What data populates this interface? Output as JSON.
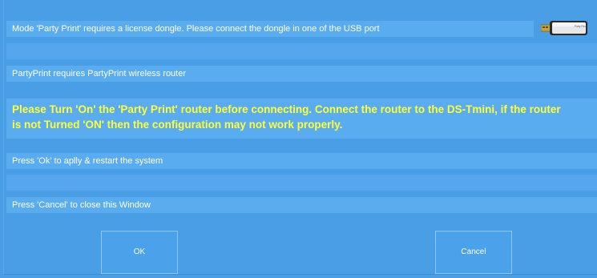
{
  "messages": {
    "dongle_notice": "Mode 'Party Print' requires a license dongle. Please connect the dongle in one of the USB port",
    "router_notice": "PartyPrint requires PartyPrint wireless router",
    "warning_line1": "Please Turn 'On' the 'Party Print' router before connecting. Connect the router to the DS-Tmini, if the router",
    "warning_line2": "is not Turned 'ON' then the configuration may not work properly.",
    "ok_hint": "Press 'Ok' to aplly  & restart the system",
    "cancel_hint": "Press 'Cancel' to close this Window"
  },
  "dongle_image": {
    "label": "Party Print",
    "icon": "usb-dongle-icon"
  },
  "buttons": {
    "ok_label": "OK",
    "cancel_label": "Cancel"
  },
  "colors": {
    "background": "#4a9ee6",
    "bar": "#5aacf0",
    "warning_text": "#ffff33",
    "text": "#ffffff"
  }
}
